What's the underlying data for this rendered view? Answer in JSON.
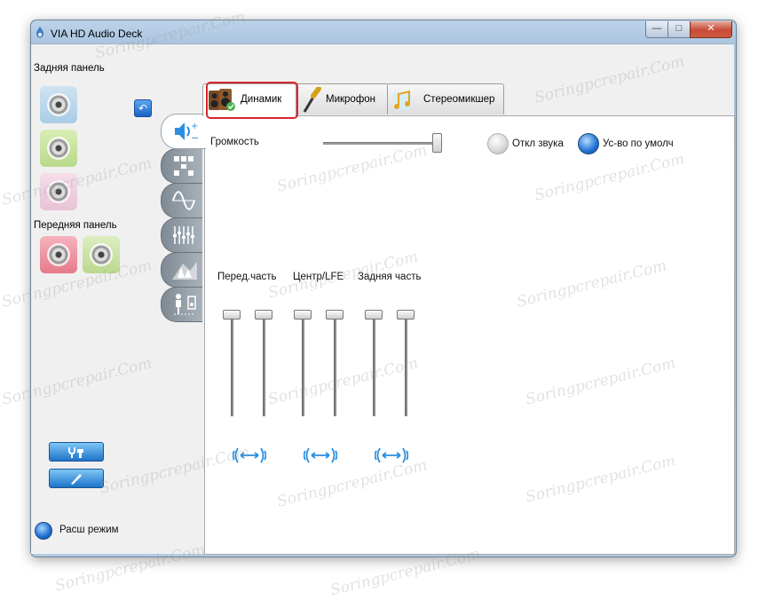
{
  "window": {
    "title": "VIA HD Audio Deck",
    "minimize_label": "—",
    "maximize_label": "□",
    "close_label": "✕"
  },
  "left_panel": {
    "rear_label": "Задняя панель",
    "front_label": "Передняя панель",
    "advanced_mode_label": "Расш режим",
    "rear_jacks": [
      "blue",
      "green",
      "pink"
    ],
    "front_jacks": [
      "red",
      "green"
    ]
  },
  "tabs": [
    {
      "label": "Динамик",
      "icon": "speakers-icon",
      "active": true
    },
    {
      "label": "Микрофон",
      "icon": "microphone-icon",
      "active": false
    },
    {
      "label": "Стереомикшер",
      "icon": "music-notes-icon",
      "active": false
    }
  ],
  "side_tabs": [
    "volume-icon",
    "speaker-config-icon",
    "sine-wave-icon",
    "equalizer-icon",
    "environment-icon",
    "room-correction-icon"
  ],
  "volume": {
    "label": "Громкость",
    "level": 0.98,
    "mute_label": "Откл звука",
    "default_label": "Ус-во по умолч"
  },
  "channels": [
    {
      "label": "Перед.часть",
      "left": 1.0,
      "right": 1.0
    },
    {
      "label": "Центр/LFE",
      "left": 1.0,
      "right": 1.0
    },
    {
      "label": "Задняя часть",
      "left": 1.0,
      "right": 1.0
    }
  ],
  "watermark": "Soringpcrepair.Com",
  "colors": {
    "accent_blue": "#1f73d3",
    "highlight_red": "#d9262c",
    "close_red": "#c74a35"
  }
}
